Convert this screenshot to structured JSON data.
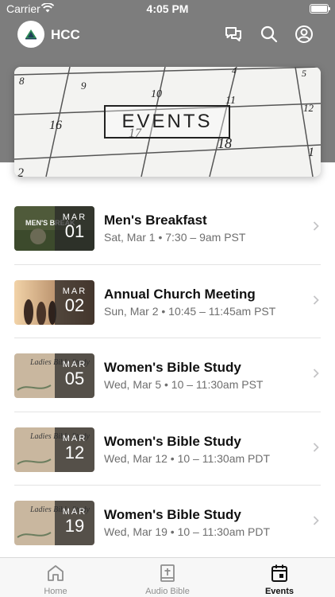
{
  "status_bar": {
    "carrier": "Carrier",
    "time": "4:05 PM"
  },
  "header": {
    "title": "HCC",
    "logo_icon": "mountain-logo-icon",
    "icons": [
      "chat-icon",
      "search-icon",
      "profile-icon"
    ]
  },
  "banner": {
    "label": "EVENTS",
    "calendar_numbers": [
      "8",
      "9",
      "10",
      "4",
      "5",
      "11",
      "12",
      "16",
      "17",
      "18",
      "1",
      "2"
    ]
  },
  "events": [
    {
      "title": "Men's Breakfast",
      "month": "MAR",
      "day": "01",
      "meta": "Sat, Mar 1 • 7:30 – 9am PST",
      "thumb_text": "MEN'S BREAK"
    },
    {
      "title": "Annual Church Meeting",
      "month": "MAR",
      "day": "02",
      "meta": "Sun, Mar 2 • 10:45 – 11:45am PST",
      "thumb_text": ""
    },
    {
      "title": "Women's Bible Study",
      "month": "MAR",
      "day": "05",
      "meta": "Wed, Mar 5 • 10 – 11:30am PST",
      "thumb_text": "Ladies Bible Study"
    },
    {
      "title": "Women's Bible Study",
      "month": "MAR",
      "day": "12",
      "meta": "Wed, Mar 12 • 10 – 11:30am PDT",
      "thumb_text": "Ladies Bible Study"
    },
    {
      "title": "Women's Bible Study",
      "month": "MAR",
      "day": "19",
      "meta": "Wed, Mar 19 • 10 – 11:30am PDT",
      "thumb_text": "Ladies Bible Study"
    }
  ],
  "tabs": [
    {
      "label": "Home",
      "icon": "home-icon",
      "active": false
    },
    {
      "label": "Audio Bible",
      "icon": "bible-icon",
      "active": false
    },
    {
      "label": "Events",
      "icon": "calendar-icon",
      "active": true
    }
  ],
  "colors": {
    "header_bg": "#7d7d7d",
    "logo_accent": "#2e8b57",
    "active_tab": "#111111",
    "inactive_tab": "#8e8e8e"
  }
}
